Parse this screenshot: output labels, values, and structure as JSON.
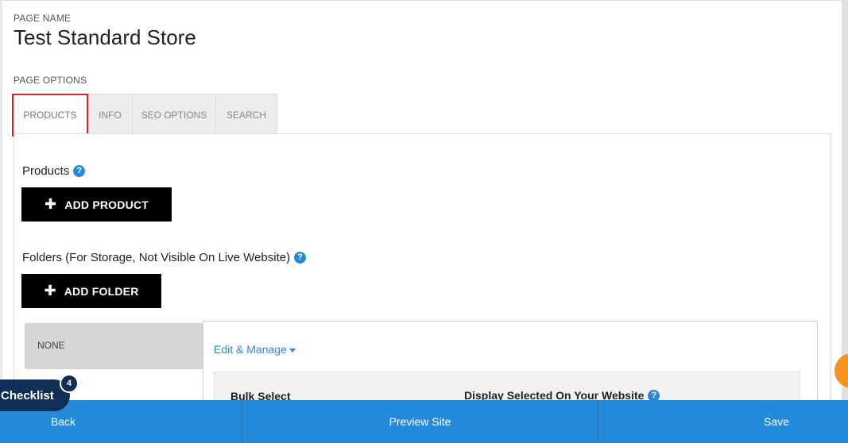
{
  "header": {
    "page_name_label": "PAGE NAME",
    "page_title": "Test Standard Store",
    "page_options_label": "PAGE OPTIONS"
  },
  "tabs": [
    {
      "label": "PRODUCTS",
      "active": true
    },
    {
      "label": "INFO",
      "active": false
    },
    {
      "label": "SEO OPTIONS",
      "active": false
    },
    {
      "label": "SEARCH",
      "active": false
    }
  ],
  "products": {
    "label": "Products",
    "add_button": "ADD PRODUCT"
  },
  "folders": {
    "label": "Folders (For Storage, Not Visible On Live Website)",
    "add_button": "ADD FOLDER",
    "selected_folder": "NONE"
  },
  "manage": {
    "edit_manage": "Edit & Manage",
    "bulk_select": "Bulk Select",
    "display_selected": "Display Selected On Your Website"
  },
  "checklist": {
    "label": "Checklist",
    "count": "4"
  },
  "bottom_bar": {
    "back": "Back",
    "preview": "Preview Site",
    "save": "Save"
  },
  "icons": {
    "help": "question-circle-icon",
    "plus": "plus-icon",
    "caret": "caret-down-icon"
  },
  "colors": {
    "accent_blue": "#258ad9",
    "active_tab_border": "#e01f26",
    "button_black": "#000000",
    "checklist_navy": "#0f2f57",
    "orange": "#f7941d"
  }
}
